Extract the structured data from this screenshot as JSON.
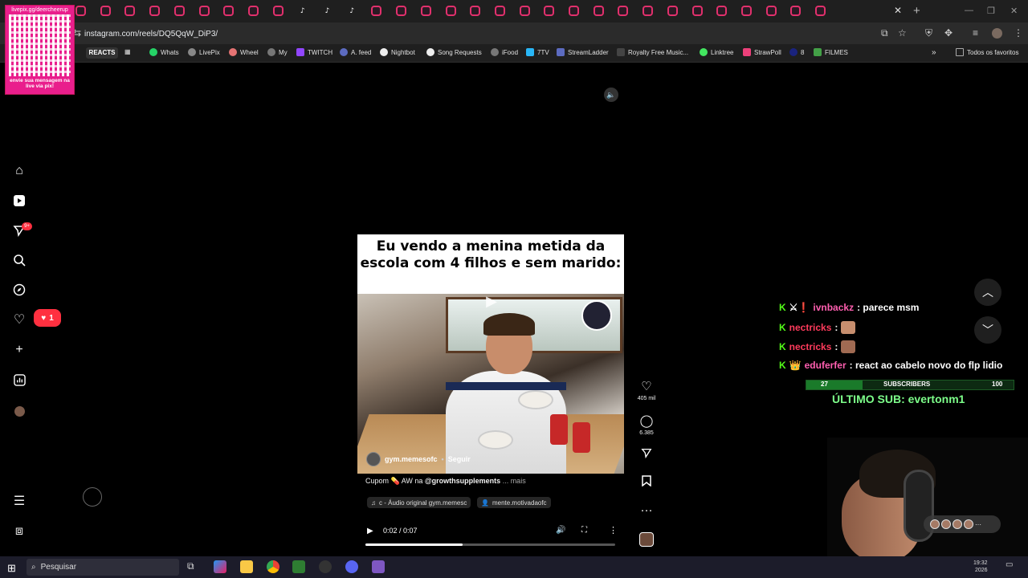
{
  "browser": {
    "url": "instagram.com/reels/DQ5QqW_DiP3/",
    "tabs": [
      {
        "kind": "ig"
      },
      {
        "kind": "ig"
      },
      {
        "kind": "ig"
      },
      {
        "kind": "ig"
      },
      {
        "kind": "ig"
      },
      {
        "kind": "ig"
      },
      {
        "kind": "ig"
      },
      {
        "kind": "ig"
      },
      {
        "kind": "ig"
      },
      {
        "kind": "tt",
        "glyph": "♪"
      },
      {
        "kind": "tt",
        "glyph": "♪"
      },
      {
        "kind": "tt",
        "glyph": "♪"
      },
      {
        "kind": "ig"
      },
      {
        "kind": "ig"
      },
      {
        "kind": "ig"
      },
      {
        "kind": "ig"
      },
      {
        "kind": "ig"
      },
      {
        "kind": "ig"
      },
      {
        "kind": "ig"
      },
      {
        "kind": "ig"
      },
      {
        "kind": "ig"
      },
      {
        "kind": "ig"
      },
      {
        "kind": "ig"
      },
      {
        "kind": "ig"
      },
      {
        "kind": "ig"
      },
      {
        "kind": "ig"
      },
      {
        "kind": "ig"
      },
      {
        "kind": "ig"
      },
      {
        "kind": "ig"
      },
      {
        "kind": "ig"
      },
      {
        "kind": "ig"
      }
    ],
    "bookmarks": {
      "reacts": "REACTS",
      "whats": "Whats",
      "livepix": "LivePix",
      "wheel": "Wheel",
      "my": "My",
      "twitch": "TWITCH",
      "afeed": "A. feed",
      "nightbot": "Nightbot",
      "songrequests": "Song Requests",
      "ifood": "iFood",
      "seventv": "7TV",
      "streamladder": "StreamLadder",
      "royalty": "Royalty Free Music...",
      "linktree": "Linktree",
      "strawpoll": "StrawPoll",
      "eight": "8",
      "filmes": "FILMES",
      "allbookmarks": "Todos os favoritos"
    }
  },
  "overlay": {
    "qr_top": "livepix.gg/deercheerup",
    "qr_bottom": "envie sua mensagem na live via pix!"
  },
  "sidebar": {
    "notif_count": "9+",
    "likes_count": "1"
  },
  "reel": {
    "caption": "Eu vendo a menina metida da escola com 4 filhos e sem marido:",
    "author": "gym.memesofc",
    "follow": "Seguir",
    "desc_prefix": "Cupom 💊 AW na ",
    "desc_mention": "@growthsupplements",
    "desc_more": " ... mais",
    "audio_chip": "c - Áudio original  gym.memesc",
    "tag_chip": "mente.motivadaofc",
    "time": "0:02 / 0:07",
    "progress": 0.39,
    "likes": "405 mil",
    "comments": "6.385"
  },
  "chat": [
    {
      "user": "ivnbackz",
      "text": ": parece msm"
    },
    {
      "user": "nectricks",
      "text": ":"
    },
    {
      "user": "nectricks",
      "text": ":"
    },
    {
      "user": "eduferfer",
      "text": ": react ao cabelo novo do flp lidio"
    }
  ],
  "subgoal": {
    "current": "27",
    "label": "SUBSCRIBERS",
    "target": "100",
    "fill": 0.27,
    "last_sub": "ÚLTIMO SUB: evertonm1"
  },
  "taskbar": {
    "search_placeholder": "Pesquisar",
    "time": "19:32",
    "date": "2026"
  },
  "colors": {
    "instagram_pink": "#e1306c",
    "kick_green": "#53fc18",
    "like_red": "#ff3040"
  }
}
